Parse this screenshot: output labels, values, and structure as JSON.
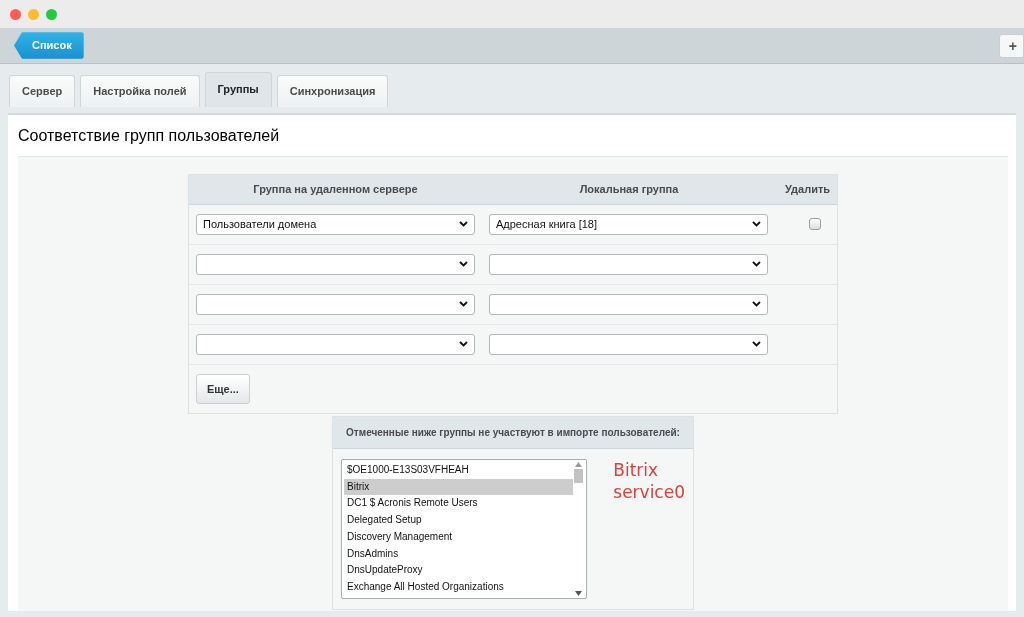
{
  "toolbar": {
    "back_button": "Список",
    "add_button": "+"
  },
  "tabs": [
    {
      "label": "Сервер",
      "selected": false
    },
    {
      "label": "Настройка полей",
      "selected": false
    },
    {
      "label": "Группы",
      "selected": true
    },
    {
      "label": "Синхронизация",
      "selected": false
    }
  ],
  "title": "Соответствие групп пользователей",
  "mapping_table": {
    "columns": [
      "Группа на удаленном сервере",
      "Локальная группа",
      "Удалить"
    ],
    "rows": [
      {
        "remote_group": "Пользователи домена",
        "local_group": "Адресная книга [18]",
        "delete_checked": false
      },
      {
        "remote_group": null,
        "local_group": null
      },
      {
        "remote_group": null,
        "local_group": null
      },
      {
        "remote_group": null,
        "local_group": null
      }
    ],
    "more_button": "Еще..."
  },
  "excluded": {
    "heading": "Отмеченные ниже группы не участвуют в импорте пользователей:",
    "items": [
      {
        "label": "$OE1000-E13S03VFHEAH",
        "selected": false
      },
      {
        "label": "Bitrix",
        "selected": true
      },
      {
        "label": "DC1 $ Acronis Remote Users",
        "selected": false
      },
      {
        "label": "Delegated Setup",
        "selected": false
      },
      {
        "label": "Discovery Management",
        "selected": false
      },
      {
        "label": "DnsAdmins",
        "selected": false
      },
      {
        "label": "DnsUpdateProxy",
        "selected": false
      },
      {
        "label": "Exchange All Hosted Organizations",
        "selected": false
      }
    ],
    "note": [
      "Bitrix",
      "service0"
    ]
  }
}
